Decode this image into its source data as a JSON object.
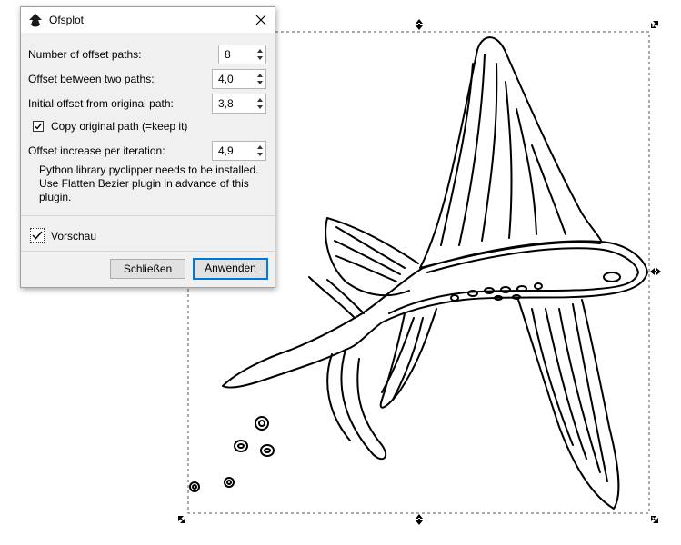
{
  "dialog": {
    "title": "Ofsplot",
    "fields": {
      "num_paths_label": "Number of offset paths:",
      "num_paths_value": "8",
      "offset_between_label": "Offset between two paths:",
      "offset_between_value": "4,0",
      "initial_offset_label": "Initial offset from original path:",
      "initial_offset_value": "3,8",
      "copy_original_label": "Copy original path (=keep it)",
      "offset_increase_label": "Offset increase per iteration:",
      "offset_increase_value": "4,9"
    },
    "info_line1": "Python library pyclipper needs to be installed.",
    "info_line2": "Use Flatten Bezier plugin in advance of this",
    "info_line3": "plugin.",
    "preview_label": "Vorschau",
    "close_label": "Schließen",
    "apply_label": "Anwenden",
    "copy_original_checked": true,
    "preview_checked": true
  },
  "icons": {
    "app": "inkscape-icon",
    "close": "close-icon",
    "handles": "resize-arrow-icon"
  },
  "colors": {
    "accent": "#0078d7",
    "line": "#000000"
  }
}
